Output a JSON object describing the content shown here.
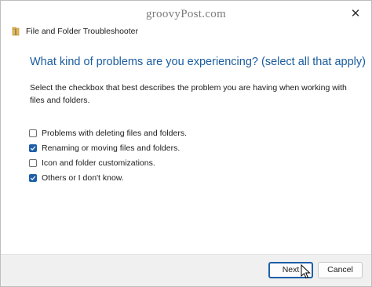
{
  "watermark": "groovyPost.com",
  "window": {
    "title": "File and Folder Troubleshooter",
    "icon": "folder-wrench-icon",
    "close_icon": "close-icon",
    "close_glyph": "✕"
  },
  "heading": "What kind of problems are you experiencing? (select all that apply)",
  "description": "Select the checkbox that best describes the problem you are having when working with files and folders.",
  "options": [
    {
      "label": "Problems with deleting files and folders.",
      "checked": false
    },
    {
      "label": "Renaming or moving files and folders.",
      "checked": true
    },
    {
      "label": "Icon and folder customizations.",
      "checked": false
    },
    {
      "label": "Others or I don't know.",
      "checked": true
    }
  ],
  "buttons": {
    "next": "Next",
    "cancel": "Cancel"
  },
  "colors": {
    "accent": "#1f5fa9",
    "heading": "#1a5c9e",
    "footer_bg": "#f0f0f0"
  }
}
